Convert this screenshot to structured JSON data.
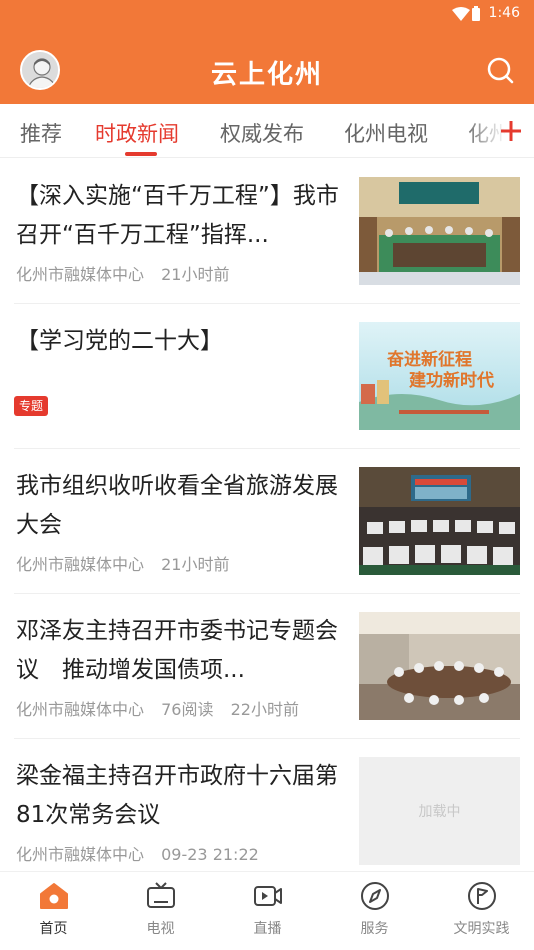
{
  "status_bar": {
    "time": "1:46"
  },
  "header": {
    "title": "云上化州"
  },
  "tabs": [
    {
      "label": "推荐"
    },
    {
      "label": "时政新闻"
    },
    {
      "label": "权威发布"
    },
    {
      "label": "化州电视"
    },
    {
      "label": "化州"
    }
  ],
  "news": [
    {
      "title": "【深入实施“百千万工程”】我市召开“百千万工程”指挥...",
      "source": "化州市融媒体中心",
      "reads": "",
      "time": "21小时前"
    },
    {
      "title": "【学习党的二十大】",
      "tag": "专题",
      "banner_line1": "奋进新征程",
      "banner_line2": "建功新时代"
    },
    {
      "title": "我市组织收听收看全省旅游发展大会",
      "source": "化州市融媒体中心",
      "reads": "",
      "time": "21小时前"
    },
    {
      "title": "邓泽友主持召开市委书记专题会议　推动增发国债项...",
      "source": "化州市融媒体中心",
      "reads": "76阅读",
      "time": "22小时前"
    },
    {
      "title": "梁金福主持召开市政府十六届第81次常务会议",
      "source": "化州市融媒体中心",
      "reads": "",
      "time": "09-23 21:22",
      "placeholder": "加载中"
    }
  ],
  "bottom_nav": [
    {
      "label": "首页"
    },
    {
      "label": "电视"
    },
    {
      "label": "直播"
    },
    {
      "label": "服务"
    },
    {
      "label": "文明实践"
    }
  ],
  "colors": {
    "brand": "#f27838",
    "accent": "#e53a2e"
  }
}
